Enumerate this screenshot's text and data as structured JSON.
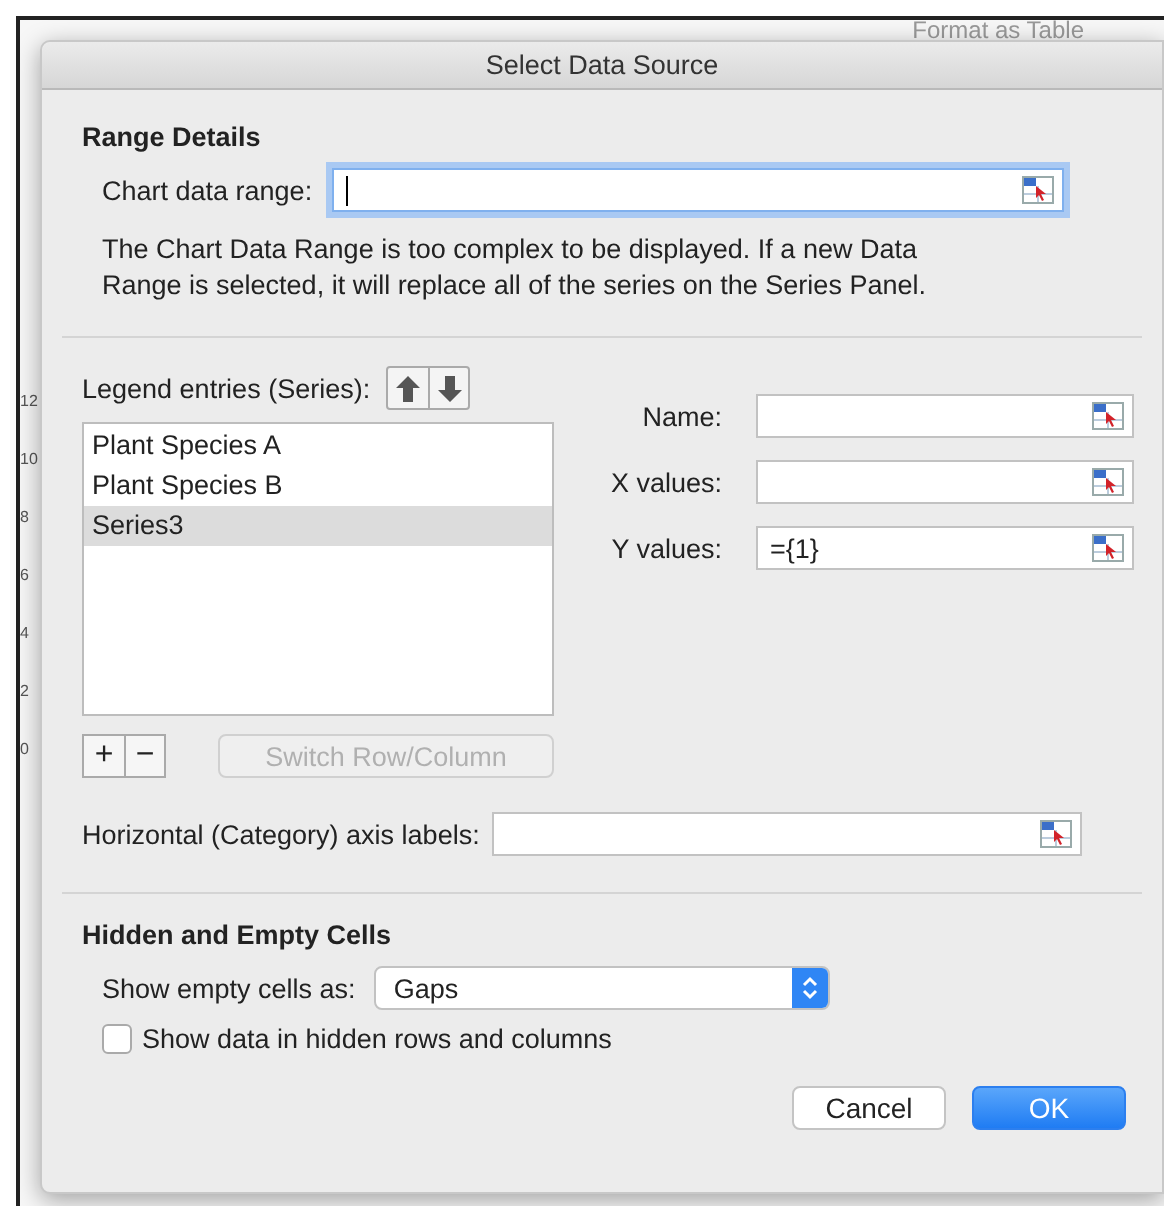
{
  "backdrop": {
    "ribbon_text": "Format as Table",
    "axis_labels": [
      "12",
      "10",
      "8",
      "6",
      "4",
      "2",
      "0"
    ]
  },
  "window": {
    "title": "Select Data Source"
  },
  "range_details": {
    "heading": "Range Details",
    "label": "Chart data range:",
    "focused": true,
    "note": "The Chart Data Range is too complex to be displayed. If a new Data Range is selected, it will replace all of the series on the Series Panel."
  },
  "legend": {
    "label": "Legend entries (Series):",
    "series": [
      {
        "name": "Plant Species A",
        "selected": false
      },
      {
        "name": "Plant Species B",
        "selected": false
      },
      {
        "name": "Series3",
        "selected": true
      }
    ],
    "add_button": "+",
    "remove_button": "−",
    "switch_button": {
      "label": "Switch Row/Column",
      "disabled": true
    }
  },
  "series_fields": [
    {
      "label": "Name:"
    },
    {
      "label": "X values:"
    },
    {
      "label": "Y values:",
      "value": "={1}"
    }
  ],
  "axis_labels": {
    "label": "Horizontal (Category) axis labels:"
  },
  "hidden_empty": {
    "heading": "Hidden and Empty Cells",
    "label": "Show empty cells as:",
    "value": "Gaps",
    "checkbox": {
      "label": "Show data in hidden rows and columns",
      "checked": false
    }
  },
  "buttons": [
    {
      "label": "Cancel",
      "kind": "secondary"
    },
    {
      "label": "OK",
      "kind": "primary"
    }
  ]
}
